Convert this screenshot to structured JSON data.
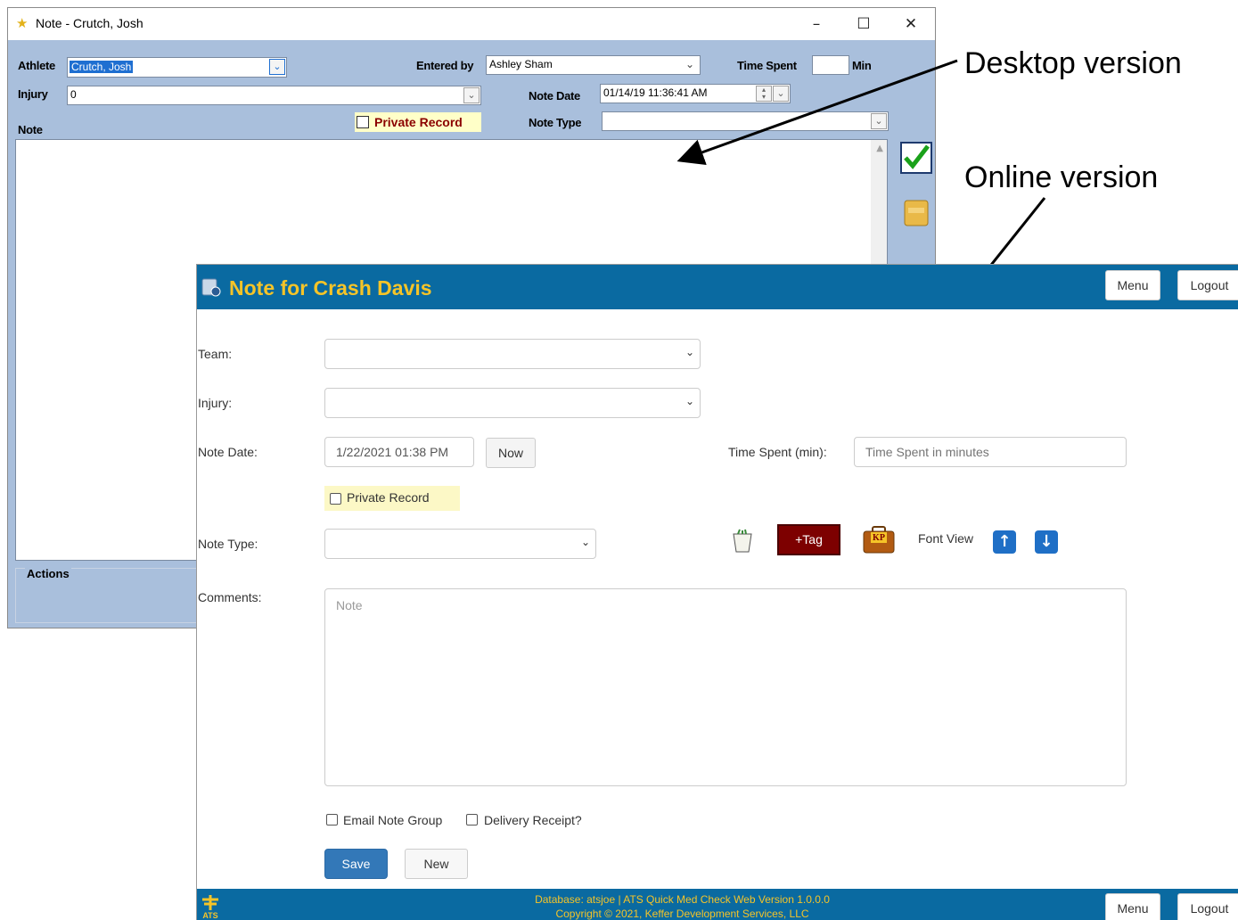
{
  "desktop": {
    "title": "Note - Crutch, Josh",
    "window_controls": {
      "minimize": "–",
      "maximize": "☐",
      "close": "✕"
    },
    "athlete_label": "Athlete",
    "athlete_value": "Crutch, Josh",
    "entered_by_label": "Entered by",
    "entered_by_value": "Ashley Sham",
    "time_spent_label": "Time Spent",
    "time_spent_value": "",
    "time_spent_unit": "Min",
    "injury_label": "Injury",
    "injury_value": "0",
    "note_date_label": "Note Date",
    "note_date_value": "01/14/19 11:36:41 AM",
    "private_record_label": "Private Record",
    "note_type_label": "Note Type",
    "note_type_value": "",
    "note_label": "Note",
    "actions_label": "Actions",
    "icons": [
      "checkmark-save-icon",
      "notes-icon"
    ]
  },
  "annotations": {
    "desktop_label": "Desktop version",
    "online_label": "Online version"
  },
  "online": {
    "header_title": "Note for Crash Davis",
    "menu_label": "Menu",
    "logout_label": "Logout",
    "team_label": "Team:",
    "team_value": "",
    "injury_label": "Injury:",
    "injury_value": "",
    "note_date_label": "Note Date:",
    "note_date_value": "1/22/2021 01:38 PM",
    "now_button": "Now",
    "time_spent_label": "Time Spent (min):",
    "time_spent_placeholder": "Time Spent in minutes",
    "private_record_label": "Private Record",
    "note_type_label": "Note Type:",
    "note_type_value": "",
    "tag_button": "+Tag",
    "kp_icon_text": "KP",
    "font_view_label": "Font View",
    "comments_label": "Comments:",
    "comments_placeholder": "Note",
    "email_note_group_label": "Email Note Group",
    "delivery_receipt_label": "Delivery Receipt?",
    "save_button": "Save",
    "new_button": "New",
    "footer_line1": "Database: atsjoe | ATS Quick Med Check Web Version 1.0.0.0",
    "footer_line2": "Copyright © 2021, Keffer Development Services, LLC",
    "footer_logo_text": "ATS",
    "colors": {
      "header": "#0a6aa1",
      "title": "#f5c428",
      "save": "#3378b8",
      "tag": "#7d0000"
    }
  }
}
